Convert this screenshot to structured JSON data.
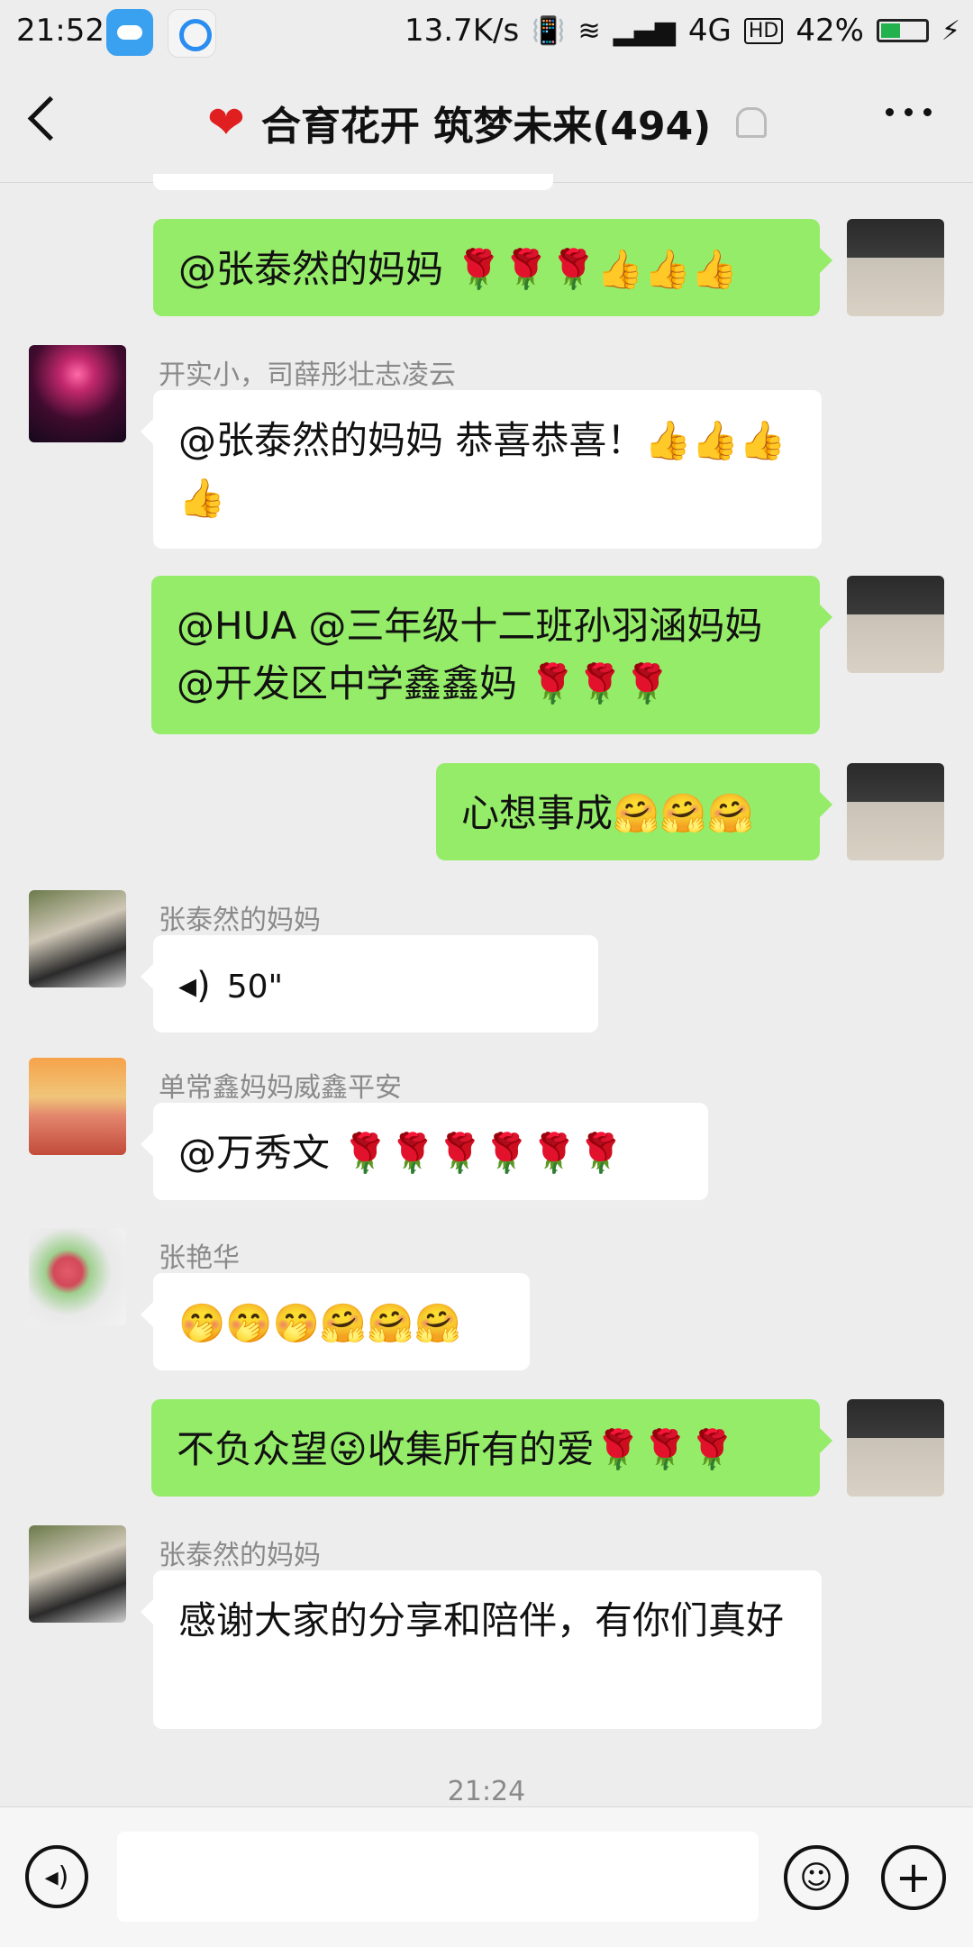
{
  "status_bar": {
    "time": "21:52",
    "speed": "13.7K/s",
    "network": "4G",
    "hd": "HD",
    "battery": "42%",
    "battery_level": 0.42
  },
  "header": {
    "title": "合育花开 筑梦未来(494)",
    "heart_icon": "❤"
  },
  "messages": [
    {
      "side": "right",
      "text": "@张泰然的妈妈 🌹🌹🌹👍👍👍"
    },
    {
      "side": "left",
      "nick": "开实小，司薛彤壮志凌云",
      "text": "@张泰然的妈妈  恭喜恭喜！👍👍👍👍"
    },
    {
      "side": "right",
      "text": "@HUA @三年级十二班孙羽涵妈妈 @开发区中学鑫鑫妈 🌹🌹🌹"
    },
    {
      "side": "right",
      "text": "心想事成🤗🤗🤗"
    },
    {
      "side": "left",
      "nick": "张泰然的妈妈",
      "voice": "50\""
    },
    {
      "side": "left",
      "nick": "单常鑫妈妈威鑫平安",
      "text": "@万秀文 🌹🌹🌹🌹🌹🌹"
    },
    {
      "side": "left",
      "nick": "张艳华",
      "text": "🤭🤭🤭🤗🤗🤗"
    },
    {
      "side": "right",
      "text": "不负众望😜收集所有的爱🌹🌹🌹"
    },
    {
      "side": "left",
      "nick": "张泰然的妈妈",
      "text": "感谢大家的分享和陪伴，有你们真好"
    }
  ],
  "timestamp": "21:24",
  "input_bar": {
    "voice_icon": "voice-icon",
    "emoji_icon": "emoji-icon",
    "plus_icon": "plus-icon"
  }
}
